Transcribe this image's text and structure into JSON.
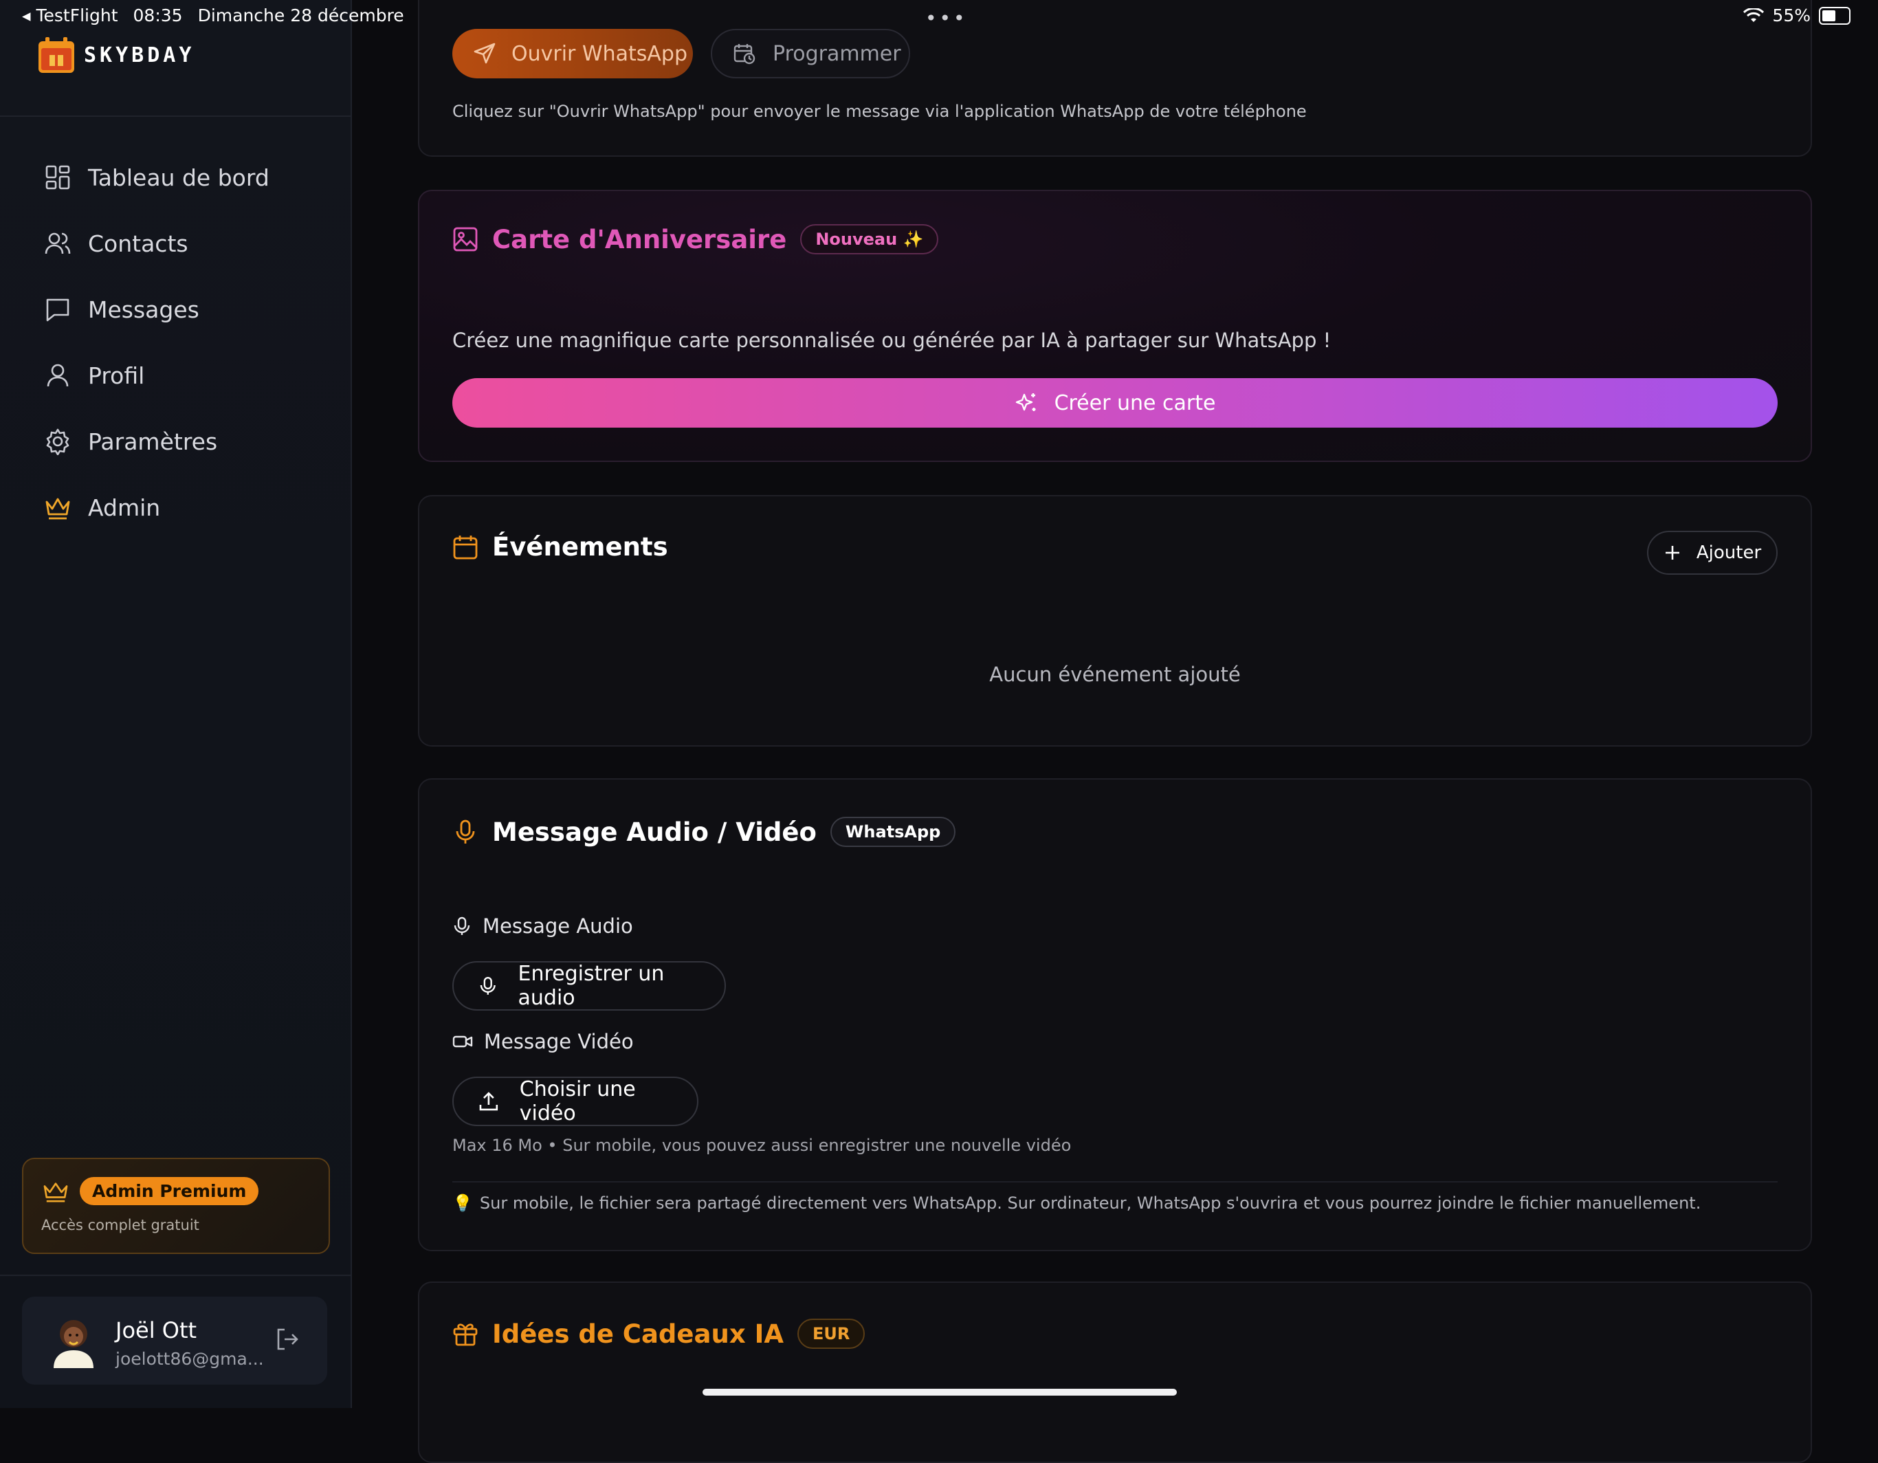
{
  "statusbar": {
    "back_app": "TestFlight",
    "time": "08:35",
    "date": "Dimanche 28 décembre",
    "battery": "55%",
    "battery_level": 0.55
  },
  "sidebar": {
    "logo_text": "SKYBDAY",
    "items": [
      {
        "label": "Tableau de bord",
        "icon": "dashboard-icon"
      },
      {
        "label": "Contacts",
        "icon": "users-icon"
      },
      {
        "label": "Messages",
        "icon": "message-icon"
      },
      {
        "label": "Profil",
        "icon": "user-icon"
      },
      {
        "label": "Paramètres",
        "icon": "gear-icon"
      },
      {
        "label": "Admin",
        "icon": "crown-icon"
      }
    ],
    "premium": {
      "badge": "Admin Premium",
      "subtitle": "Accès complet gratuit"
    },
    "user": {
      "name": "Joël Ott",
      "email": "joelott86@gma..."
    }
  },
  "send_card": {
    "open_whatsapp": "Ouvrir WhatsApp",
    "schedule": "Programmer",
    "hint": "Cliquez sur \"Ouvrir WhatsApp\" pour envoyer le message via l'application WhatsApp de votre téléphone"
  },
  "birthday_card": {
    "title": "Carte d'Anniversaire",
    "badge": "Nouveau ✨",
    "description": "Créez une magnifique carte personnalisée ou générée par IA à partager sur WhatsApp !",
    "button": "Créer une carte"
  },
  "events_card": {
    "title": "Événements",
    "add_button": "Ajouter",
    "empty": "Aucun événement ajouté"
  },
  "media_card": {
    "title": "Message Audio / Vidéo",
    "badge": "WhatsApp",
    "audio_label": "Message Audio",
    "audio_button": "Enregistrer un audio",
    "video_label": "Message Vidéo",
    "video_button": "Choisir une vidéo",
    "limits": "Max 16 Mo • Sur mobile, vous pouvez aussi enregistrer une nouvelle vidéo",
    "tip": "Sur mobile, le fichier sera partagé directement vers WhatsApp. Sur ordinateur, WhatsApp s'ouvrira et vous pourrez joindre le fichier manuellement."
  },
  "gifts_card": {
    "title": "Idées de Cadeaux IA",
    "badge": "EUR"
  },
  "colors": {
    "accent_orange": "#f0931d",
    "accent_pink": "#e058b8",
    "accent_purple": "#a352ea"
  }
}
